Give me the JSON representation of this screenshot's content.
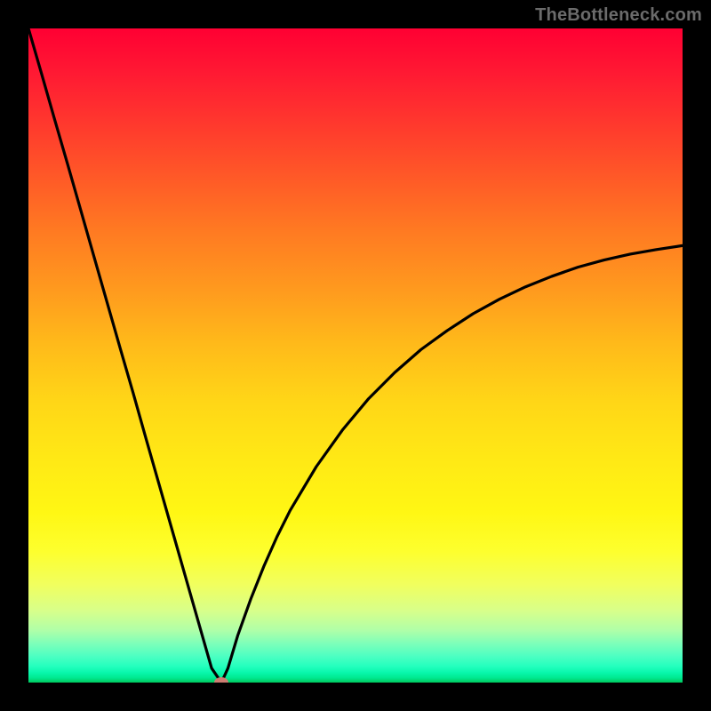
{
  "watermark": "TheBottleneck.com",
  "colors": {
    "frame": "#000000",
    "curve": "#000000",
    "marker": "#cd7d72"
  },
  "chart_data": {
    "type": "line",
    "title": "",
    "xlabel": "",
    "ylabel": "",
    "xlim": [
      0,
      100
    ],
    "ylim": [
      0,
      100
    ],
    "grid": false,
    "legend": false,
    "series": [
      {
        "name": "bottleneck-curve",
        "x": [
          0,
          2,
          4,
          6,
          8,
          10,
          12,
          14,
          16,
          18,
          20,
          22,
          24,
          26,
          28,
          29.5,
          30.5,
          32,
          34,
          36,
          38,
          40,
          44,
          48,
          52,
          56,
          60,
          64,
          68,
          72,
          76,
          80,
          84,
          88,
          92,
          96,
          100
        ],
        "y": [
          100,
          93.1,
          86.1,
          79.2,
          72.2,
          65.2,
          58.2,
          51.2,
          44.3,
          37.2,
          30.2,
          23.2,
          16.2,
          9.2,
          2.2,
          0.0,
          2.2,
          7.2,
          12.8,
          17.8,
          22.3,
          26.3,
          33.0,
          38.6,
          43.4,
          47.4,
          50.9,
          53.8,
          56.4,
          58.6,
          60.5,
          62.1,
          63.5,
          64.6,
          65.5,
          66.2,
          66.8
        ]
      }
    ],
    "annotations": [
      {
        "name": "optimal-point",
        "x": 29.5,
        "y": 0.0
      }
    ],
    "background_gradient": {
      "orientation": "vertical",
      "stops": [
        {
          "pos": 0.0,
          "color": "#ff0033"
        },
        {
          "pos": 0.5,
          "color": "#ffd617"
        },
        {
          "pos": 0.8,
          "color": "#fdff2e"
        },
        {
          "pos": 1.0,
          "color": "#00c95e"
        }
      ]
    }
  }
}
